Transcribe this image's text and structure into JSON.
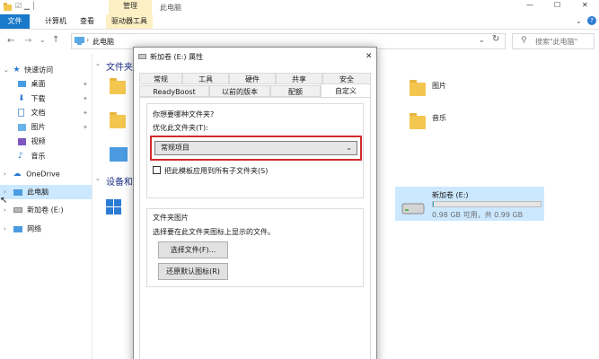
{
  "window": {
    "title": "此电脑",
    "context_header": "管理",
    "controls": {
      "minimize": "—",
      "maximize": "☐",
      "close": "✕"
    }
  },
  "ribbon": {
    "tabs": [
      "文件",
      "计算机",
      "查看",
      "驱动器工具"
    ]
  },
  "address": {
    "path_root_sep": "›",
    "path": "此电脑",
    "search_placeholder": "搜索\"此电脑\""
  },
  "sidebar": {
    "items": [
      {
        "label": "快速访问"
      },
      {
        "label": "桌面"
      },
      {
        "label": "下载"
      },
      {
        "label": "文档"
      },
      {
        "label": "图片"
      },
      {
        "label": "视频"
      },
      {
        "label": "音乐"
      },
      {
        "label": "OneDrive"
      },
      {
        "label": "此电脑"
      },
      {
        "label": "新加卷 (E:)"
      },
      {
        "label": "网络"
      }
    ]
  },
  "content": {
    "folders_header": "文件夹",
    "devices_header": "设备和",
    "right_folders": [
      {
        "label": "图片"
      },
      {
        "label": "音乐"
      }
    ],
    "drive": {
      "label": "新加卷 (E:)",
      "detail": "0.98 GB 可用，共 0.99 GB",
      "used_fraction": 0.01
    }
  },
  "dialog": {
    "title": "新加卷 (E:) 属性",
    "close": "✕",
    "tabs_row1": [
      "常规",
      "工具",
      "硬件",
      "共享",
      "安全"
    ],
    "tabs_row2": [
      "ReadyBoost",
      "以前的版本",
      "配额",
      "自定义"
    ],
    "active_tab": "自定义",
    "question": "你想要哪种文件夹?",
    "optimize_label": "优化此文件夹(T):",
    "optimize_value": "常规项目",
    "apply_sub_label": "把此模板应用到所有子文件夹(S)",
    "folder_pictures_title": "文件夹图片",
    "folder_pictures_desc": "选择要在此文件夹图标上显示的文件。",
    "choose_file_button": "选择文件(F)...",
    "restore_default_button": "还原默认图标(R)"
  }
}
